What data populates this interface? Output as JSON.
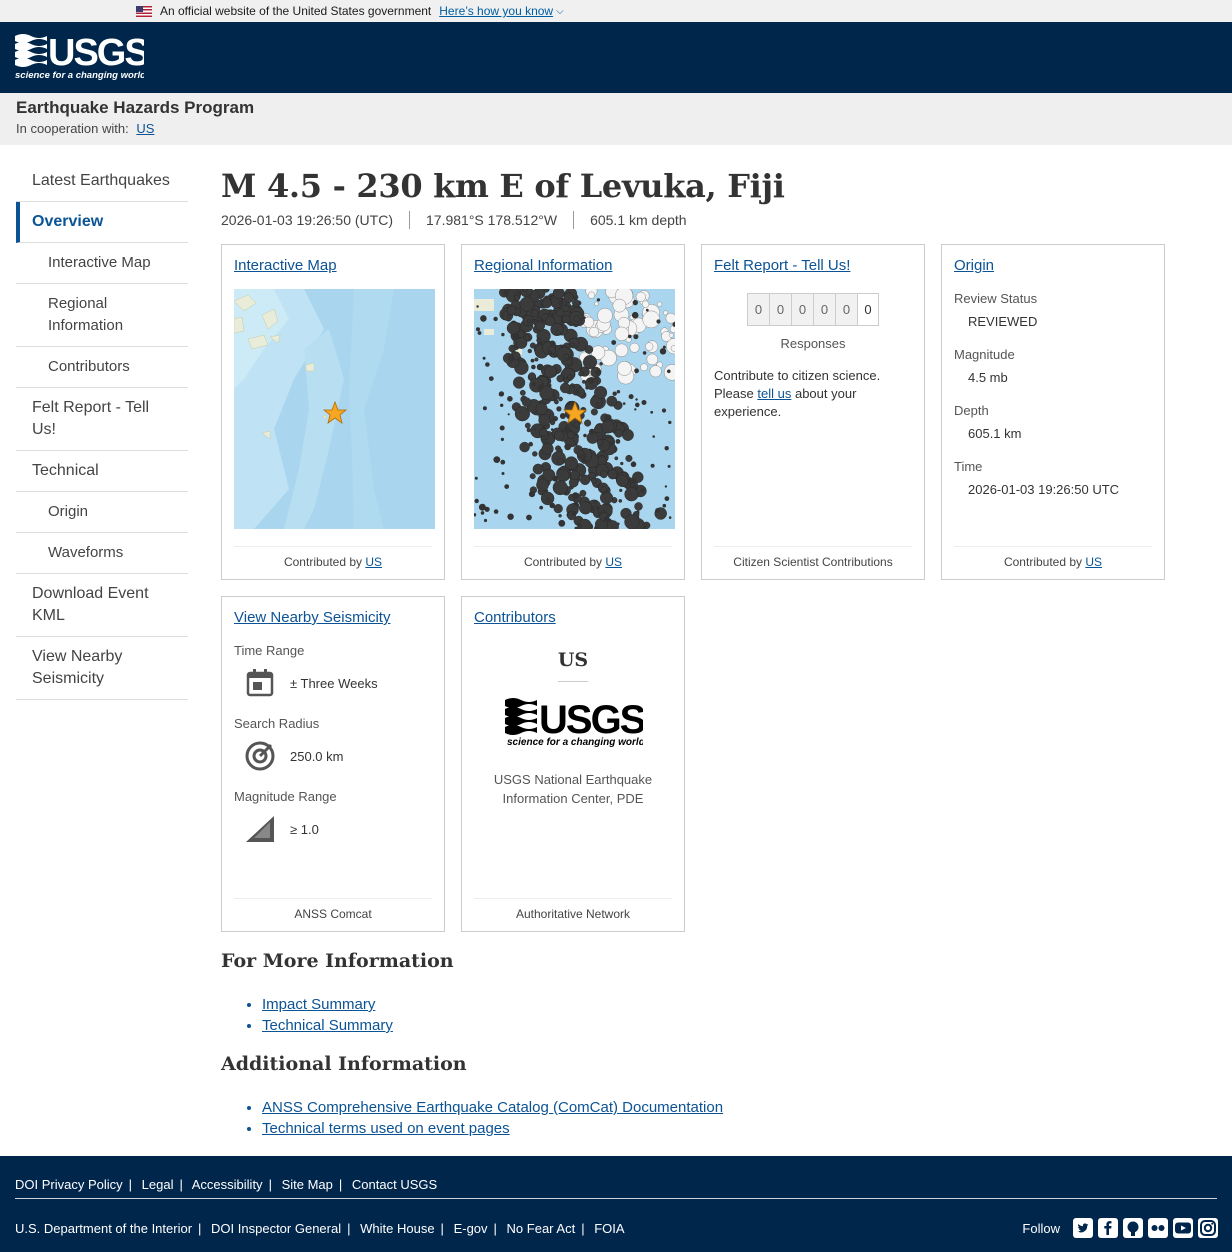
{
  "gov_banner": {
    "text": "An official website of the United States government",
    "link": "Here’s how you know"
  },
  "header": {
    "logo_text": "USGS",
    "logo_tagline": "science for a changing world"
  },
  "program": {
    "title": "Earthquake Hazards Program",
    "coop_label": "In cooperation with:",
    "coop_link": "US"
  },
  "sidebar": {
    "items": [
      {
        "label": "Latest Earthquakes"
      },
      {
        "label": "Overview"
      },
      {
        "label": "Interactive Map"
      },
      {
        "label": "Regional Information"
      },
      {
        "label": "Contributors"
      },
      {
        "label": "Felt Report - Tell Us!"
      },
      {
        "label": "Technical"
      },
      {
        "label": "Origin"
      },
      {
        "label": "Waveforms"
      },
      {
        "label": "Download Event KML"
      },
      {
        "label": "View Nearby Seismicity"
      }
    ]
  },
  "event": {
    "title": "M 4.5 - 230 km E of Levuka, Fiji",
    "time": "2026-01-03 19:26:50 (UTC)",
    "location": "17.981°S 178.512°W",
    "depth": "605.1 km depth"
  },
  "cards": {
    "interactive_map": {
      "title": "Interactive Map",
      "footer_prefix": "Contributed by",
      "footer_link": "US"
    },
    "regional": {
      "title": "Regional Information",
      "footer_prefix": "Contributed by",
      "footer_link": "US"
    },
    "felt": {
      "title": "Felt Report - Tell Us!",
      "digits": [
        "0",
        "0",
        "0",
        "0",
        "0",
        "0"
      ],
      "responses_label": "Responses",
      "text_1": "Contribute to citizen science.",
      "text_2": "Please",
      "text_link": "tell us",
      "text_3": "about your experience.",
      "footer": "Citizen Scientist Contributions"
    },
    "origin": {
      "title": "Origin",
      "review_label": "Review Status",
      "review_value": "REVIEWED",
      "mag_label": "Magnitude",
      "mag_value": "4.5 mb",
      "depth_label": "Depth",
      "depth_value": "605.1 km",
      "time_label": "Time",
      "time_value": "2026-01-03 19:26:50 UTC",
      "footer_prefix": "Contributed by",
      "footer_link": "US"
    },
    "nearby": {
      "title": "View Nearby Seismicity",
      "time_label": "Time Range",
      "time_value": "± Three Weeks",
      "radius_label": "Search Radius",
      "radius_value": "250.0 km",
      "mag_label": "Magnitude Range",
      "mag_value": "≥ 1.0",
      "footer": "ANSS Comcat"
    },
    "contributors": {
      "title": "Contributors",
      "code": "US",
      "logo_text": "USGS",
      "logo_tagline": "science for a changing world",
      "name": "USGS National Earthquake Information Center, PDE",
      "footer": "Authoritative Network"
    }
  },
  "more_info": {
    "heading": "For More Information",
    "links": [
      "Impact Summary",
      "Technical Summary"
    ]
  },
  "additional_info": {
    "heading": "Additional Information",
    "links": [
      "ANSS Comprehensive Earthquake Catalog (ComCat) Documentation",
      "Technical terms used on event pages"
    ]
  },
  "footer": {
    "row1": [
      "DOI Privacy Policy",
      "Legal",
      "Accessibility",
      "Site Map",
      "Contact USGS"
    ],
    "row2": [
      "U.S. Department of the Interior",
      "DOI Inspector General",
      "White House",
      "E-gov",
      "No Fear Act",
      "FOIA"
    ],
    "follow_label": "Follow",
    "social_icons": [
      "twitter-icon",
      "facebook-icon",
      "github-icon",
      "flickr-icon",
      "youtube-icon",
      "instagram-icon"
    ]
  },
  "colors": {
    "header_bg": "#00264c",
    "link": "#0b5394",
    "star": "#f5a623"
  }
}
